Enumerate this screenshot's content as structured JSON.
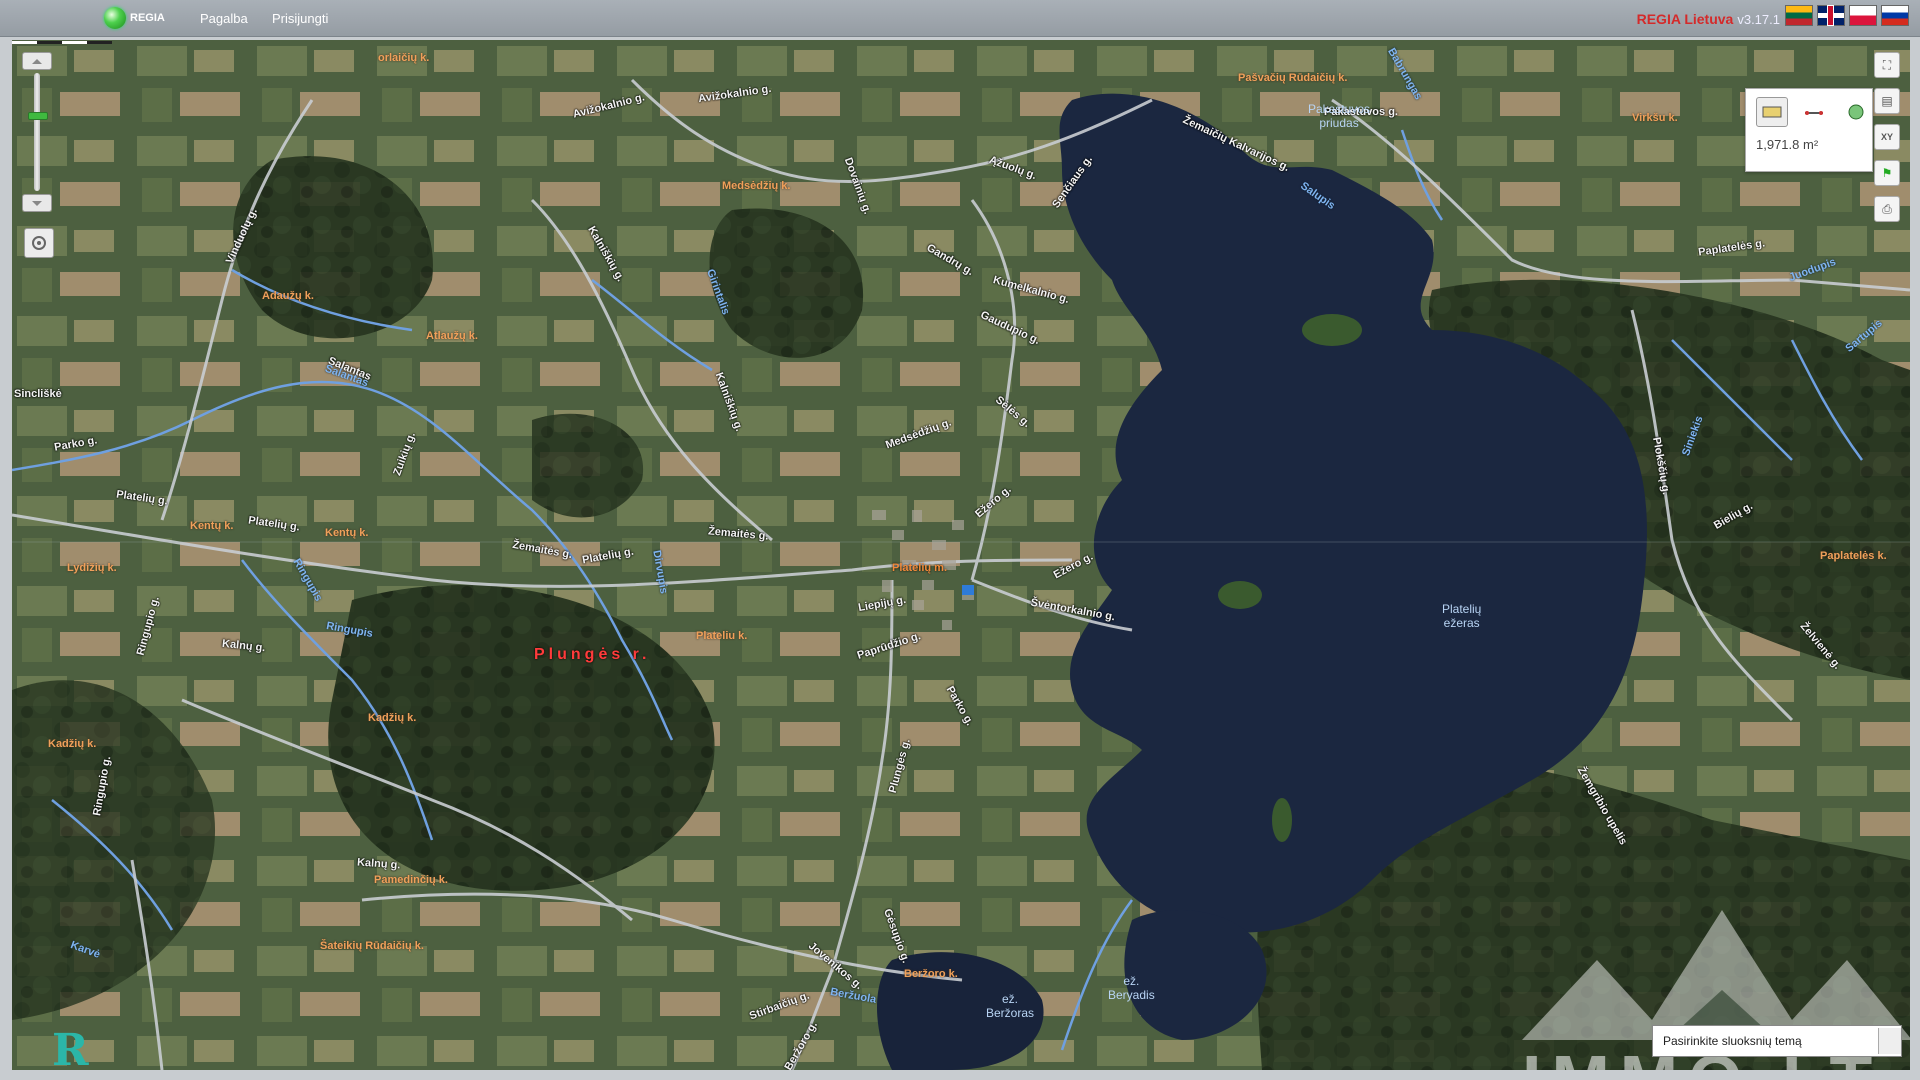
{
  "header": {
    "logo_text": "REGIA",
    "menu": [
      "Pagalba",
      "Prisijungti"
    ],
    "brand": "REGIA Lietuva",
    "version": "v3.17.1",
    "flags": [
      "lt-flag-icon",
      "gb-flag-icon",
      "pl-flag-icon",
      "ru-flag-icon"
    ]
  },
  "map": {
    "labels": {
      "district": "Plungės r.",
      "villages": [
        "orlaičių k.",
        "Medsėdžių k.",
        "Adaužų k.",
        "Atlaužų k.",
        "Kentų k.",
        "Kentų k.",
        "Lydižių k.",
        "Plateliu k.",
        "Kadžių k.",
        "Kadžių k.",
        "Pamedinčių k.",
        "Šateikių Rūdaičių k.",
        "Beržoro k.",
        "Pašvačių Rūdaičių k.",
        "Virkšu k.",
        "Paplatelės k."
      ],
      "town": "Platelių m.",
      "roads": [
        "Avižokalnio g.",
        "Avižokalnio g.",
        "Kalniškių g.",
        "Kalniškių g.",
        "Platelių g.",
        "Platelių g.",
        "Žemaitės g.",
        "Žemaitės g.",
        "Ežero g.",
        "Ežero g.",
        "Švėntorkalnio g.",
        "Paprūdžio g.",
        "Liepijų g.",
        "Parko g.",
        "Plungės g.",
        "Kalnų g.",
        "Kalnų g.",
        "Salantas",
        "Sincliškė",
        "Vinduolų g.",
        "Ringupio g.",
        "Ringupio g.",
        "Dovainių g.",
        "Gandrų g.",
        "Kumelkalnio g.",
        "Gaudupio g.",
        "Sėlės g.",
        "Medsėdžių g.",
        "Ąžuolų g.",
        "Senčiaus g.",
        "Žemaičių Kalvarijos g.",
        "Paplatelės g.",
        "Pakastuvos g.",
        "Plokščių g.",
        "Bielių g.",
        "Želvienė g.",
        "Žemgribio upelis",
        "Gėsupio g.",
        "Jovenikos g.",
        "Stirbaičių g.",
        "Zuikių g.",
        "Parko g.",
        "Platelių g.",
        "Beržoro g."
      ],
      "waters": [
        "Salantas",
        "Ringupis",
        "Ringupis",
        "Dirvupis",
        "Girintalis",
        "Beržuola",
        "Salupis",
        "Juodupis",
        "Sartupis",
        "Karvė",
        "Babrungas",
        "Siniekis"
      ],
      "lakes": [
        {
          "name": "Platelių\nežeras"
        },
        {
          "name": "ež.\nBeržoras"
        },
        {
          "name": "ež.\nBeryadis"
        },
        {
          "name": "Pakastuvos\npriudas"
        }
      ]
    }
  },
  "controls": {
    "zoom_in": "zoom-in",
    "zoom_out": "zoom-out",
    "zoom_level": 0.35,
    "measure_value": "1,971.8 m²",
    "theme_label": "Pasirinkite sluoksnių temą",
    "right_tools": [
      "fullscreen-icon",
      "layers-icon",
      "xy-coordinates-icon",
      "flag-icon",
      "print-icon"
    ]
  },
  "watermark": {
    "text": "IMMO.LT"
  },
  "colors": {
    "topbar": "#9ea5ac",
    "brand_red": "#d42a2a",
    "lake": "#1a2a44",
    "roads": "#c9cdd2",
    "rivers": "#6fa0e0"
  }
}
